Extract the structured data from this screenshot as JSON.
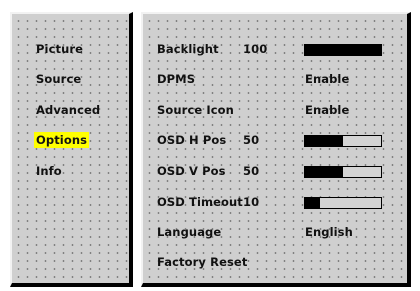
{
  "menu": [
    {
      "label": "Picture",
      "selected": false
    },
    {
      "label": "Source",
      "selected": false
    },
    {
      "label": "Advanced",
      "selected": false
    },
    {
      "label": "Options",
      "selected": true
    },
    {
      "label": "Info",
      "selected": false
    }
  ],
  "settings": [
    {
      "label": "Backlight",
      "value": "100",
      "bar_fraction": 1.0
    },
    {
      "label": "DPMS",
      "option": "Enable"
    },
    {
      "label": "Source Icon",
      "option": "Enable"
    },
    {
      "label": "OSD H Pos",
      "value": "50",
      "bar_fraction": 0.5
    },
    {
      "label": "OSD V Pos",
      "value": "50",
      "bar_fraction": 0.5
    },
    {
      "label": "OSD Timeout",
      "value": "10",
      "bar_fraction": 0.2
    },
    {
      "label": "Language",
      "option": "English"
    },
    {
      "label": "Factory Reset"
    }
  ],
  "colors": {
    "panel_bg": "#cfcfcf",
    "highlight": "#ffff00",
    "bar_fill": "#000000"
  }
}
